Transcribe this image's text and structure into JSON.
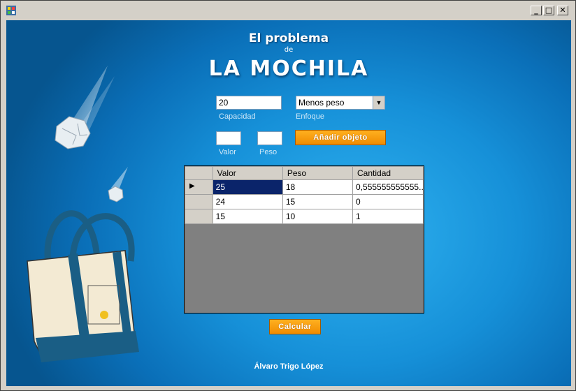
{
  "header": {
    "line1": "El problema",
    "line2": "de",
    "line3": "LA MOCHILA"
  },
  "window": {
    "min_glyph": "_",
    "max_glyph": "□",
    "close_glyph": "✕"
  },
  "form": {
    "capacidad_value": "20",
    "capacidad_label": "Capacidad",
    "enfoque_value": "Menos peso",
    "enfoque_label": "Enfoque",
    "valor_value": "",
    "valor_label": "Valor",
    "peso_value": "",
    "peso_label": "Peso",
    "add_button": "Añadir objeto"
  },
  "grid": {
    "columns": [
      "Valor",
      "Peso",
      "Cantidad"
    ],
    "rows": [
      [
        "25",
        "18",
        "0,555555555555..."
      ],
      [
        "24",
        "15",
        "0"
      ],
      [
        "15",
        "10",
        "1"
      ]
    ]
  },
  "calc_button": "Calcular",
  "footer": "Álvaro Trigo López",
  "colors": {
    "accent_orange": "#f5a000",
    "background_blue": "#1690d8",
    "selection": "#0a246a"
  },
  "icons": [
    "app-icon",
    "current-row-icon",
    "crumpled-paper-icon",
    "tote-bag-illustration"
  ]
}
